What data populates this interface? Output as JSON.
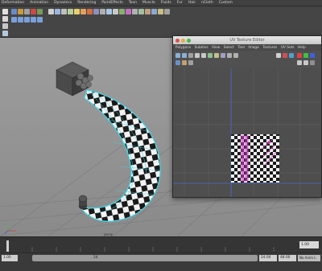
{
  "main_menu": {
    "items": [
      "Deformation",
      "Animation",
      "Dynamics",
      "Rendering",
      "PaintEffects",
      "Toon",
      "Muscle",
      "Fluids",
      "Fur",
      "Hair",
      "nCloth",
      "Custom"
    ]
  },
  "uv_editor": {
    "title": "UV Texture Editor",
    "menu": [
      "Polygons",
      "Subdivs",
      "View",
      "Select",
      "Tool",
      "Image",
      "Textures",
      "UV Sets",
      "Help"
    ]
  },
  "viewport": {
    "camera_label": "persp"
  },
  "range_bar": {
    "start": "1.00",
    "current_frame": "24",
    "end_a": "24.00",
    "end_b": "48.00",
    "anim_layer": "No Anim L",
    "frame_field": "1.00"
  },
  "colors": {
    "uv_shell_highlight": "#d33cc8",
    "wireframe_selected": "#3fd7e8",
    "checker_dark": "#1a1a1a",
    "checker_light": "#f2f2f2"
  }
}
